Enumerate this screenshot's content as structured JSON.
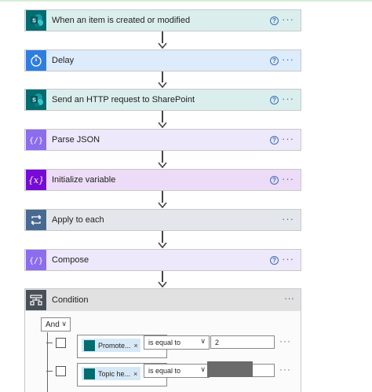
{
  "steps": [
    {
      "title": "When an item is created or modified",
      "icon": "sharepoint-icon",
      "color": "#036c70",
      "bg": "#dbeeee",
      "help": true
    },
    {
      "title": "Delay",
      "icon": "timer-icon",
      "color": "#2f7de1",
      "bg": "#ddecfb",
      "help": true
    },
    {
      "title": "Send an HTTP request to SharePoint",
      "icon": "sharepoint-icon",
      "color": "#036c70",
      "bg": "#dbeeee",
      "help": true
    },
    {
      "title": "Parse JSON",
      "icon": "data-operation-icon",
      "color": "#8c6cef",
      "bg": "#eee8fb",
      "help": true
    },
    {
      "title": "Initialize variable",
      "icon": "variable-icon",
      "color": "#770bd6",
      "bg": "#ecdcf7",
      "help": true
    },
    {
      "title": "Apply to each",
      "icon": "loop-icon",
      "color": "#486991",
      "bg": "#e3e7ec",
      "help": false
    },
    {
      "title": "Compose",
      "icon": "data-operation-icon",
      "color": "#8c6cef",
      "bg": "#eee8fb",
      "help": true
    }
  ],
  "help_glyph": "?",
  "more_glyph": "···",
  "condition": {
    "title": "Condition",
    "icon": "condition-icon",
    "color": "#484f58",
    "group_operator": "And",
    "rows": [
      {
        "token": "Promote...",
        "operator": "is equal to",
        "value": "2"
      },
      {
        "token": "Topic he...",
        "operator": "is equal to",
        "value": ""
      }
    ]
  }
}
